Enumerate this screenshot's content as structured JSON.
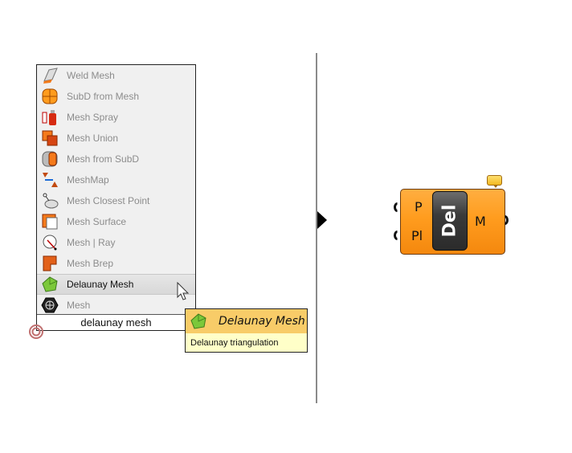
{
  "popup": {
    "items": [
      {
        "label": "Weld Mesh",
        "icon": "weld-mesh-icon",
        "selected": false
      },
      {
        "label": "SubD from Mesh",
        "icon": "subd-from-mesh-icon",
        "selected": false
      },
      {
        "label": "Mesh Spray",
        "icon": "mesh-spray-icon",
        "selected": false
      },
      {
        "label": "Mesh Union",
        "icon": "mesh-union-icon",
        "selected": false
      },
      {
        "label": "Mesh from SubD",
        "icon": "mesh-from-subd-icon",
        "selected": false
      },
      {
        "label": "MeshMap",
        "icon": "meshmap-icon",
        "selected": false
      },
      {
        "label": "Mesh Closest Point",
        "icon": "mesh-closest-point-icon",
        "selected": false
      },
      {
        "label": "Mesh Surface",
        "icon": "mesh-surface-icon",
        "selected": false
      },
      {
        "label": "Mesh | Ray",
        "icon": "mesh-ray-icon",
        "selected": false
      },
      {
        "label": "Mesh Brep",
        "icon": "mesh-brep-icon",
        "selected": false
      },
      {
        "label": "Delaunay Mesh",
        "icon": "delaunay-mesh-icon",
        "selected": true
      },
      {
        "label": "Mesh",
        "icon": "mesh-icon",
        "selected": false
      }
    ],
    "search_value": "delaunay mesh"
  },
  "tooltip": {
    "title": "Delaunay Mesh",
    "description": "Delaunay triangulation"
  },
  "component": {
    "nickname": "Del",
    "inputs": [
      "P",
      "Pl"
    ],
    "outputs": [
      "M"
    ],
    "color": "#ff9c1e"
  }
}
